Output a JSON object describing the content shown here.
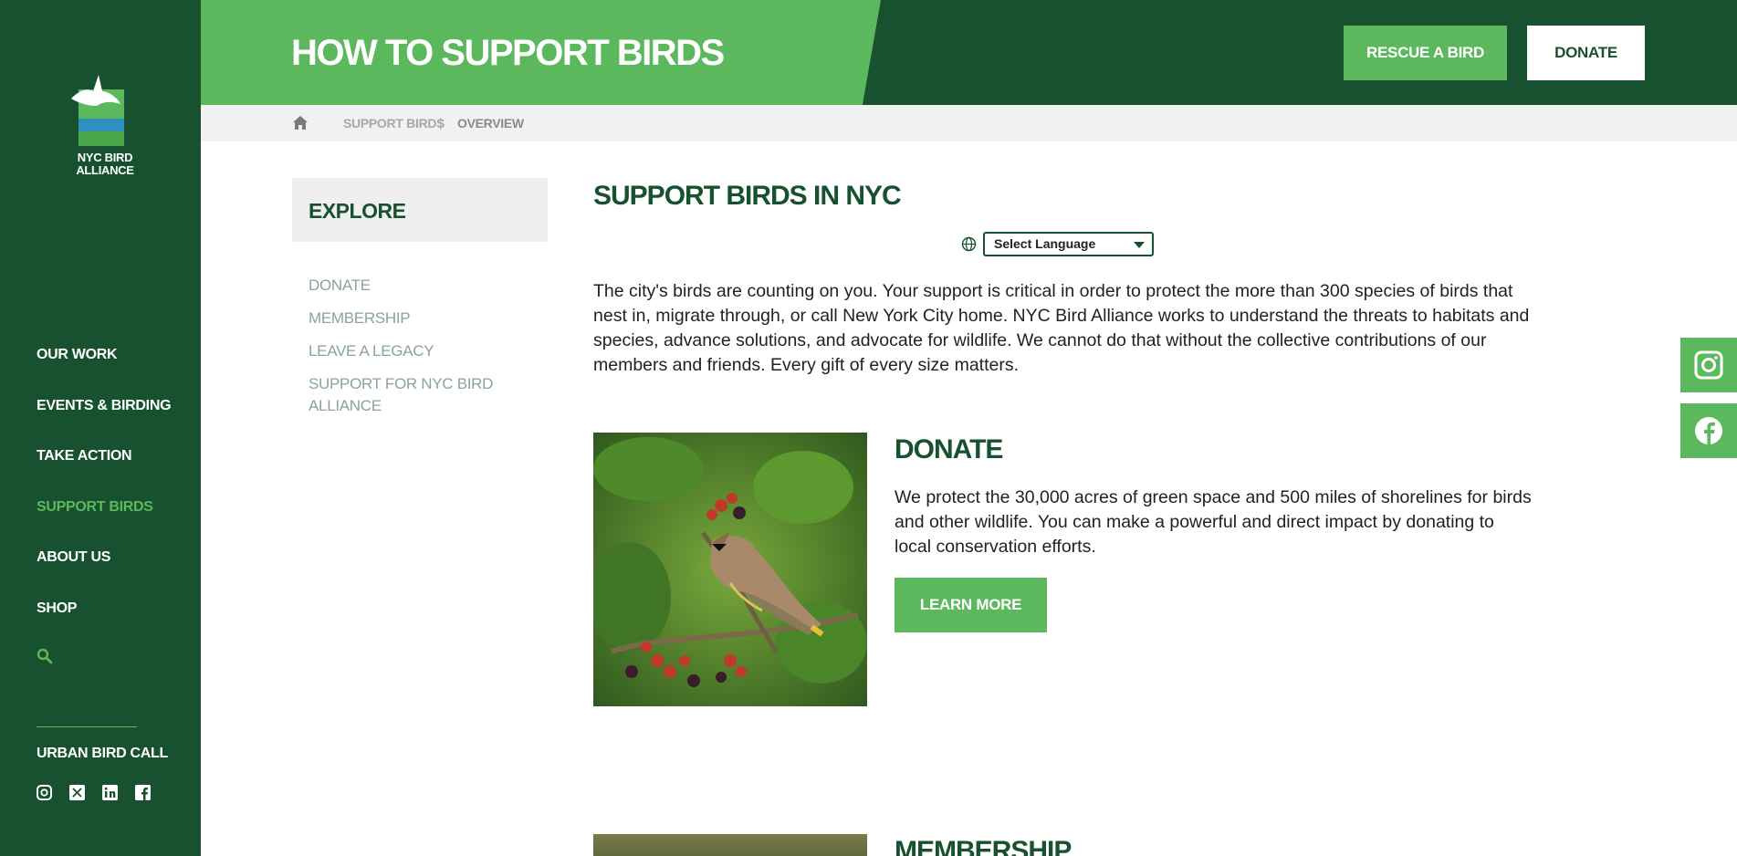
{
  "brand": {
    "logo_text": "NYC BIRD ALLIANCE"
  },
  "sidebar": {
    "items": [
      {
        "label": "OUR WORK"
      },
      {
        "label": "EVENTS & BIRDING"
      },
      {
        "label": "TAKE ACTION"
      },
      {
        "label": "SUPPORT BIRDS",
        "active": true
      },
      {
        "label": "ABOUT US"
      },
      {
        "label": "SHOP"
      }
    ],
    "search_icon": "search-icon",
    "urban_bird_call": "URBAN BIRD CALL",
    "social_icons": [
      "instagram-icon",
      "x-twitter-icon",
      "linkedin-icon",
      "facebook-icon"
    ]
  },
  "header": {
    "title": "HOW TO SUPPORT BIRDS",
    "rescue_label": "RESCUE A BIRD",
    "donate_label": "DONATE"
  },
  "breadcrumb": {
    "home_icon": "home-icon",
    "section": "SUPPORT BIRDS",
    "separator": "|",
    "current": "OVERVIEW"
  },
  "explore": {
    "title": "EXPLORE",
    "links": [
      "DONATE",
      "MEMBERSHIP",
      "LEAVE A LEGACY",
      "SUPPORT FOR NYC BIRD ALLIANCE"
    ]
  },
  "main": {
    "title": "SUPPORT BIRDS IN NYC",
    "language_select": "Select Language",
    "intro": "The city's birds are counting on you. Your support is critical in order to protect the more than 300 species of birds that nest in, migrate through, or call New York City home. NYC Bird Alliance works to understand the threats to habitats and species, advance solutions, and advocate for wildlife. We cannot do that without the collective contributions of our members and friends. Every gift of every size matters.",
    "donate": {
      "title": "DONATE",
      "text": "We protect the 30,000 acres of green space and 500 miles of shorelines for birds and other wildlife.  You can make a powerful and direct impact by donating to local conservation efforts.",
      "button": "LEARN MORE"
    },
    "membership": {
      "title": "MEMBERSHIP"
    }
  },
  "colors": {
    "dark_green": "#17512f",
    "accent_green": "#5cb85c",
    "muted_link": "#8aa593"
  }
}
